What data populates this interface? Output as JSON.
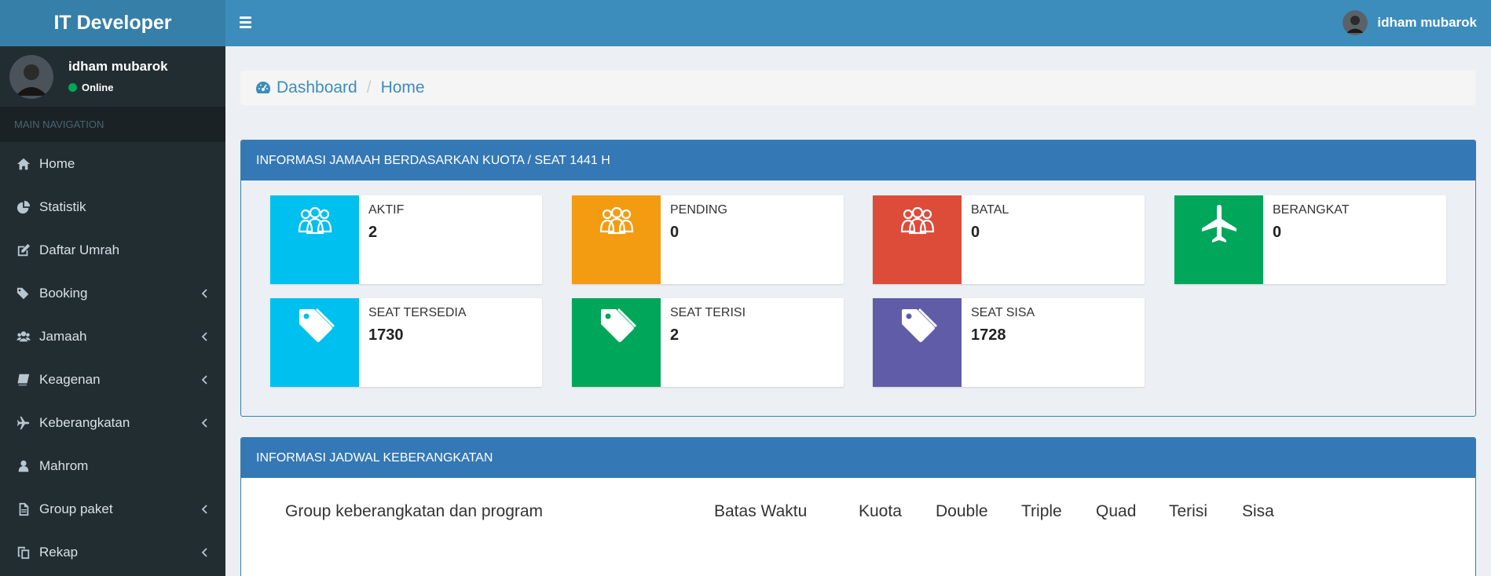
{
  "app": {
    "brand": "IT Developer"
  },
  "user": {
    "name": "idham mubarok",
    "status": "Online"
  },
  "sidebar": {
    "header": "MAIN NAVIGATION",
    "items": [
      {
        "label": "Home",
        "icon": "home-icon"
      },
      {
        "label": "Statistik",
        "icon": "pie-chart-icon"
      },
      {
        "label": "Daftar Umrah",
        "icon": "edit-icon"
      },
      {
        "label": "Booking",
        "icon": "tags-icon"
      },
      {
        "label": "Jamaah",
        "icon": "users-icon"
      },
      {
        "label": "Keagenan",
        "icon": "book-icon"
      },
      {
        "label": "Keberangkatan",
        "icon": "plane-icon"
      },
      {
        "label": "Mahrom",
        "icon": "user-icon"
      },
      {
        "label": "Group paket",
        "icon": "file-icon"
      },
      {
        "label": "Rekap",
        "icon": "copy-icon"
      }
    ]
  },
  "breadcrumb": {
    "dashboard": "Dashboard",
    "home": "Home",
    "separator": "/"
  },
  "quota_panel": {
    "title": "INFORMASI JAMAAH BERDASARKAN KUOTA / SEAT 1441 H",
    "boxes": [
      {
        "label": "AKTIF",
        "value": "2",
        "color": "#00c0ef",
        "icon": "group-icon"
      },
      {
        "label": "PENDING",
        "value": "0",
        "color": "#f39c12",
        "icon": "group-icon"
      },
      {
        "label": "BATAL",
        "value": "0",
        "color": "#dd4b39",
        "icon": "group-icon"
      },
      {
        "label": "BERANGKAT",
        "value": "0",
        "color": "#00a65a",
        "icon": "plane-icon"
      },
      {
        "label": "SEAT TERSEDIA",
        "value": "1730",
        "color": "#00c0ef",
        "icon": "tag-icon"
      },
      {
        "label": "SEAT TERISI",
        "value": "2",
        "color": "#00a65a",
        "icon": "tag-icon"
      },
      {
        "label": "SEAT SISA",
        "value": "1728",
        "color": "#605ca8",
        "icon": "tag-icon"
      }
    ]
  },
  "schedule_panel": {
    "title": "INFORMASI JADWAL KEBERANGKATAN",
    "columns": [
      "Group keberangkatan dan program",
      "Batas Waktu",
      "Kuota",
      "Double",
      "Triple",
      "Quad",
      "Terisi",
      "Sisa"
    ]
  },
  "colors": {
    "primary": "#3c8dbc",
    "sidebar": "#222d32",
    "panel_header": "#3478b5"
  }
}
